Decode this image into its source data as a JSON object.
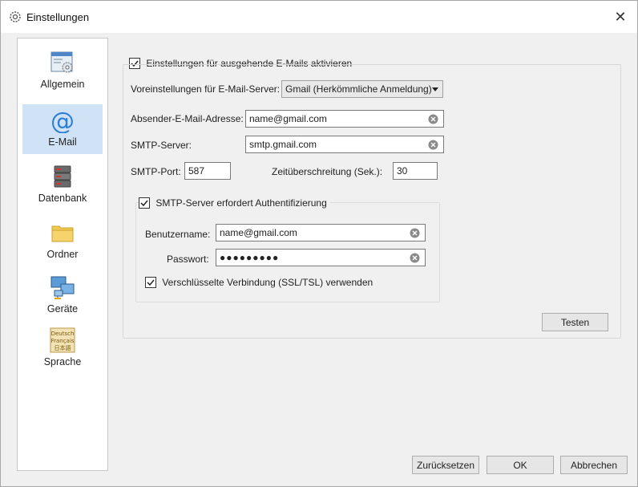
{
  "window": {
    "title": "Einstellungen",
    "close_glyph": "✕"
  },
  "sidebar": {
    "items": [
      {
        "label": "Allgemein",
        "icon": "general-settings-icon"
      },
      {
        "label": "E-Mail",
        "icon": "at-sign-icon",
        "selected": true
      },
      {
        "label": "Datenbank",
        "icon": "database-icon"
      },
      {
        "label": "Ordner",
        "icon": "folder-icon"
      },
      {
        "label": "Geräte",
        "icon": "devices-icon"
      },
      {
        "label": "Sprache",
        "icon": "language-icon",
        "icon_lines": [
          "Deutsch",
          "Français",
          "日本語"
        ]
      }
    ]
  },
  "email": {
    "enable_label": "Einstellungen für ausgehende E-Mails aktivieren",
    "enable_checked": true,
    "preset_label": "Voreinstellungen für E-Mail-Server:",
    "preset_value": "Gmail (Herkömmliche Anmeldung)",
    "sender_label": "Absender-E-Mail-Adresse:",
    "sender_value": "name@gmail.com",
    "smtp_server_label": "SMTP-Server:",
    "smtp_server_value": "smtp.gmail.com",
    "smtp_port_label": "SMTP-Port:",
    "smtp_port_value": "587",
    "timeout_label": "Zeitüberschreitung (Sek.):",
    "timeout_value": "30",
    "auth_label": "SMTP-Server erfordert Authentifizierung",
    "auth_checked": true,
    "username_label": "Benutzername:",
    "username_value": "name@gmail.com",
    "password_label": "Passwort:",
    "password_value": "●●●●●●●●●",
    "ssl_label": "Verschlüsselte Verbindung (SSL/TSL) verwenden",
    "ssl_checked": true,
    "test_button": "Testen"
  },
  "footer": {
    "reset_button": "Zurücksetzen",
    "ok_button": "OK",
    "cancel_button": "Abbrechen"
  },
  "colors": {
    "selected_bg": "#cfe2f6",
    "at_sign": "#2f7fd6"
  }
}
